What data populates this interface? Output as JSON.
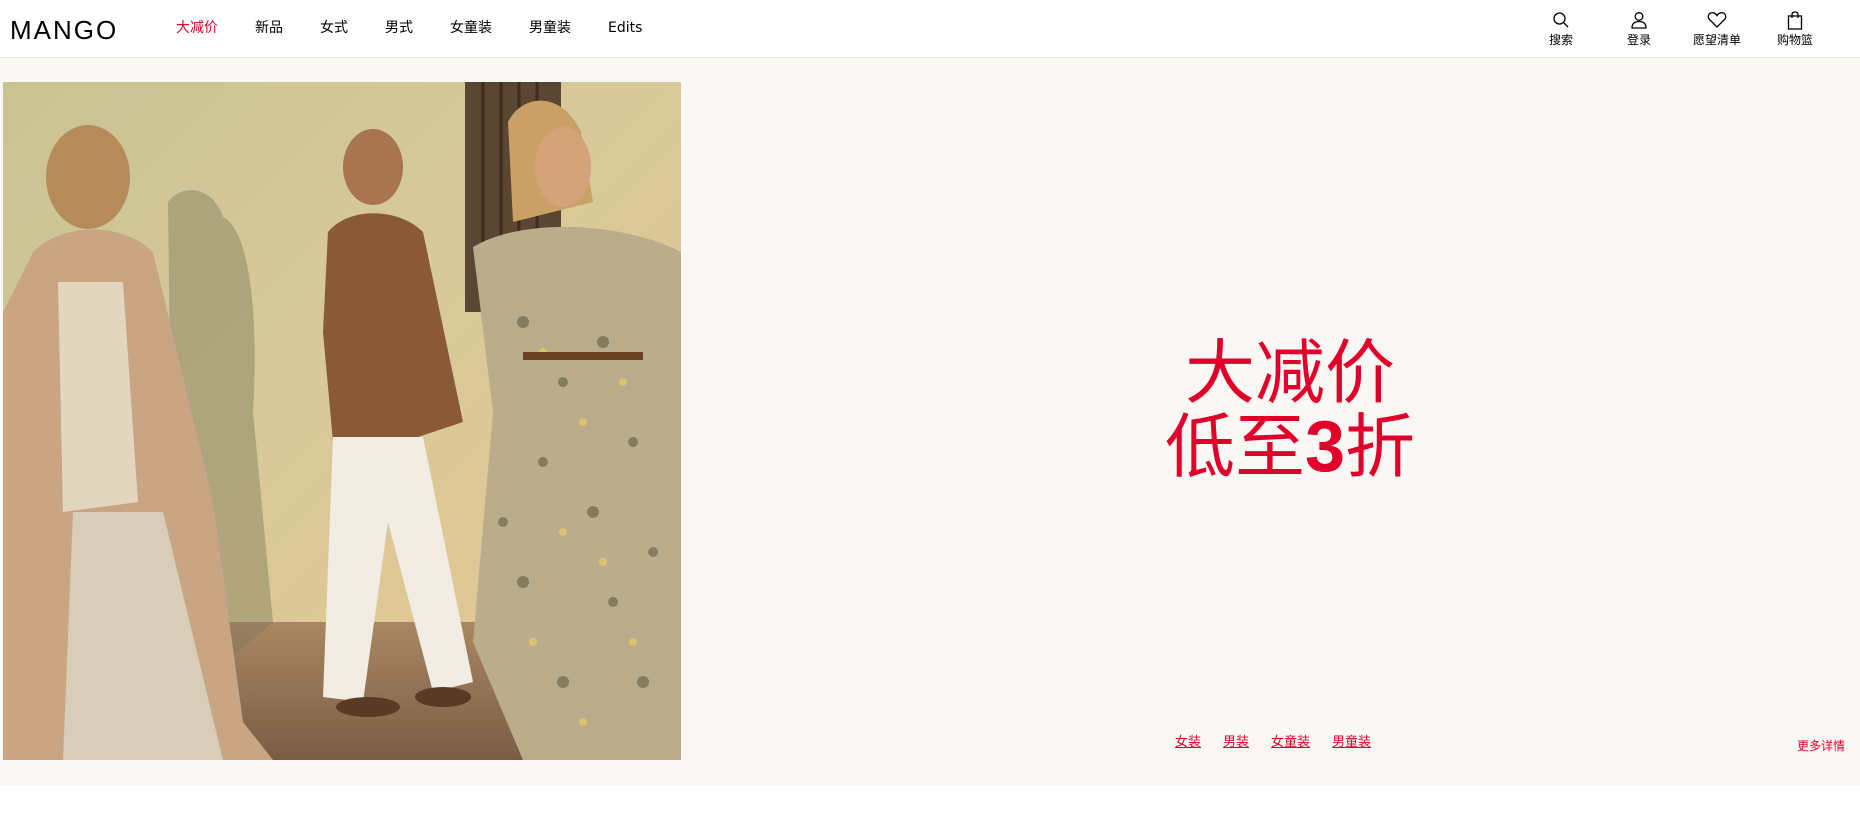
{
  "header": {
    "logo": "MANGO",
    "nav": [
      {
        "label": "大减价",
        "highlight": true
      },
      {
        "label": "新品"
      },
      {
        "label": "女式"
      },
      {
        "label": "男式"
      },
      {
        "label": "女童装"
      },
      {
        "label": "男童装"
      },
      {
        "label": "Edits"
      }
    ],
    "actions": {
      "search": {
        "label": "搜索",
        "icon": "search-icon"
      },
      "login": {
        "label": "登录",
        "icon": "user-icon"
      },
      "wishlist": {
        "label": "愿望清单",
        "icon": "heart-icon"
      },
      "cart": {
        "label": "购物篮",
        "icon": "shopping-bag-icon"
      }
    }
  },
  "hero": {
    "headline_line1": "大减价",
    "headline_line2_prefix": "低至",
    "headline_number": "3",
    "headline_line2_suffix": "折",
    "links": [
      "女装",
      "男装",
      "女童装",
      "男童装"
    ],
    "more_details": "更多详情"
  },
  "colors": {
    "accent": "#e0002a",
    "hero_background": "#faf8f5"
  }
}
